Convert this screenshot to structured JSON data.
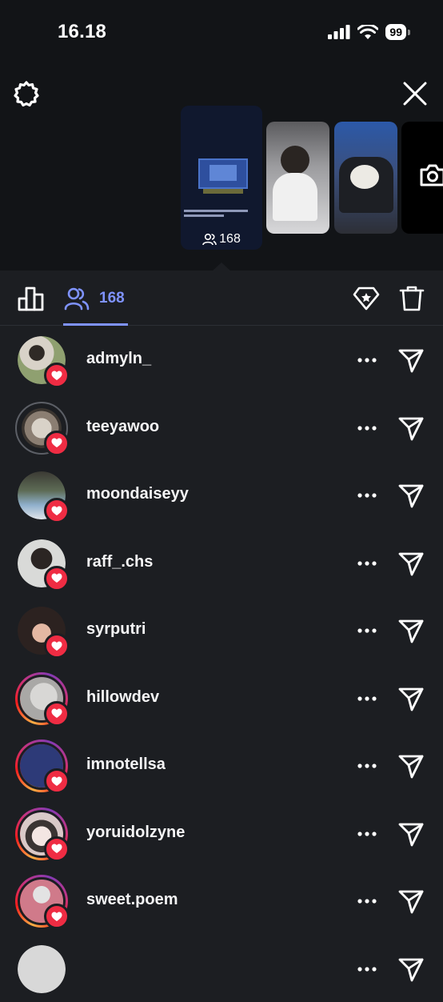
{
  "status_bar": {
    "time": "16.18",
    "battery": "99"
  },
  "story": {
    "viewer_count": "168",
    "thumbnails": [
      "current-story",
      "story-2",
      "story-3",
      "camera"
    ]
  },
  "tabs": {
    "viewers_count": "168"
  },
  "colors": {
    "accent": "#7f93ff",
    "heart": "#ef2c43",
    "background": "#1c1e22",
    "header_background": "#121417"
  },
  "viewers": [
    {
      "username": "admyln_",
      "ring": "none"
    },
    {
      "username": "teeyawoo",
      "ring": "grey"
    },
    {
      "username": "moondaiseyy",
      "ring": "none"
    },
    {
      "username": "raff_.chs",
      "ring": "none"
    },
    {
      "username": "syrputri",
      "ring": "none"
    },
    {
      "username": "hillowdev",
      "ring": "story"
    },
    {
      "username": "imnotellsa",
      "ring": "story"
    },
    {
      "username": "yoruidolzyne",
      "ring": "story"
    },
    {
      "username": "sweet.poem",
      "ring": "story"
    },
    {
      "username": "",
      "ring": "none"
    }
  ]
}
